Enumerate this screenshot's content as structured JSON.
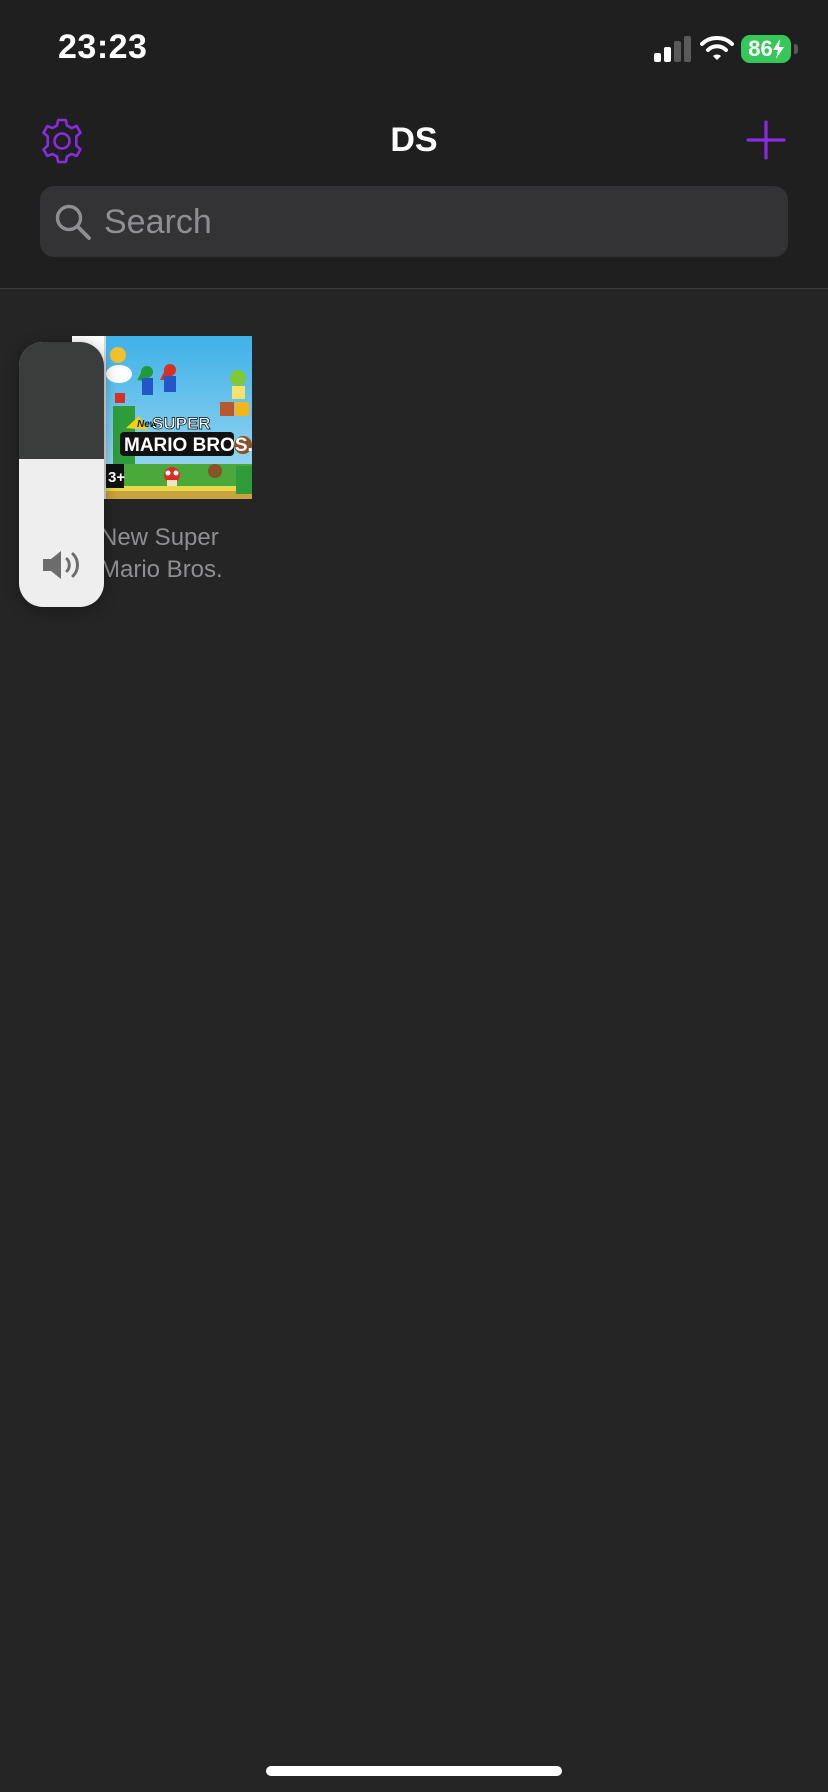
{
  "status_bar": {
    "time": "23:23",
    "battery_level": "86",
    "signal_bars_active": 2,
    "signal_bars_total": 4,
    "charging": true
  },
  "nav": {
    "title": "DS",
    "left_icon": "gear-icon",
    "right_icon": "plus-icon"
  },
  "search": {
    "placeholder": "Search",
    "value": ""
  },
  "games": [
    {
      "title": "New Super Mario Bros.",
      "art_title_line1": "SUPER",
      "art_title_line2": "MARIO BROS.",
      "art_badge": "New",
      "art_rating": "3+"
    }
  ],
  "volume_hud": {
    "level": 0.56,
    "icon": "speaker-icon"
  },
  "colors": {
    "background": "#252525",
    "nav_background": "#1f1f1f",
    "accent": "#8a2be2",
    "battery": "#35c759",
    "search_field": "#333336",
    "secondary_text": "#8f8f93"
  }
}
